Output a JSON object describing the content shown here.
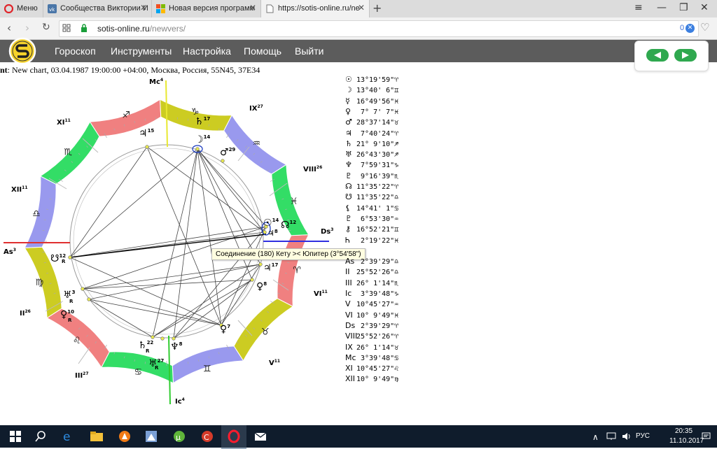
{
  "browser": {
    "tabs": [
      {
        "label": "Меню",
        "active": false
      },
      {
        "label": "Сообщества Виктории И",
        "active": false
      },
      {
        "label": "Новая версия программ",
        "active": false
      },
      {
        "label": "https://sotis-online.ru/ne",
        "active": true
      }
    ],
    "new_tab": "+",
    "url_host": "sotis-online.ru",
    "url_path": "/newvers/",
    "adblock_count": "0"
  },
  "site": {
    "menu": [
      "Гороскоп",
      "Инструменты",
      "Настройка",
      "Помощь",
      "Выйти"
    ],
    "chart_info_prefix": "nt",
    "chart_info": ": New chart, 03.04.1987 19:00:00 +04:00, Москва, Россия, 55N45, 37E34"
  },
  "wheel": {
    "zodiac_colors": {
      "fire": "#f08080",
      "earth": "#cccc22",
      "air": "#9999ee",
      "water": "#33dd66"
    },
    "house_labels": [
      {
        "label": "Mc",
        "sup": "4"
      },
      {
        "label": "IX",
        "sup": "27"
      },
      {
        "label": "VIII",
        "sup": "26"
      },
      {
        "label": "Ds",
        "sup": "3"
      },
      {
        "label": "VI",
        "sup": "11"
      },
      {
        "label": "V",
        "sup": "11"
      },
      {
        "label": "Ic",
        "sup": "4"
      },
      {
        "label": "III",
        "sup": "27"
      },
      {
        "label": "II",
        "sup": "26"
      },
      {
        "label": "As",
        "sup": "3"
      },
      {
        "label": "XII",
        "sup": "11"
      },
      {
        "label": "XI",
        "sup": "11"
      }
    ],
    "planet_labels": [
      {
        "glyph": "♄",
        "deg": "17"
      },
      {
        "glyph": "♃",
        "deg": "15"
      },
      {
        "glyph": "☽",
        "deg": "14"
      },
      {
        "glyph": "♂",
        "deg": "29"
      },
      {
        "glyph": "☉",
        "deg": "14"
      },
      {
        "glyph": "☊",
        "deg": "12"
      },
      {
        "glyph": "♃",
        "deg": "8"
      },
      {
        "glyph": "☋",
        "deg": "12",
        "retro": "R"
      },
      {
        "glyph": "♃",
        "deg": "17"
      },
      {
        "glyph": "♀",
        "deg": "8"
      },
      {
        "glyph": "♅",
        "deg": "3",
        "retro": "R"
      },
      {
        "glyph": "♀",
        "deg": "10",
        "retro": "R"
      },
      {
        "glyph": "♀",
        "deg": "7"
      },
      {
        "glyph": "♄",
        "deg": "22",
        "retro": "R"
      },
      {
        "glyph": "♆",
        "deg": "8"
      },
      {
        "glyph": "♅",
        "deg": "27",
        "retro": "R"
      }
    ]
  },
  "tooltip": "Соединение (180) Кету >< Юпитер (3°54'58\")",
  "planet_table": [
    {
      "glyph": "☉",
      "value": "13°19'59\"♈"
    },
    {
      "glyph": "☽",
      "value": "13°40' 6\"♊"
    },
    {
      "glyph": "☿",
      "value": "16°49'56\"♓"
    },
    {
      "glyph": "♀",
      "value": " 7° 7' 7\"♓"
    },
    {
      "glyph": "♂",
      "value": "28°37'14\"♉"
    },
    {
      "glyph": "♃",
      "value": " 7°40'24\"♈"
    },
    {
      "glyph": "♄",
      "value": "21° 9'10\"♐"
    },
    {
      "glyph": "♅",
      "value": "26°43'30\"♐"
    },
    {
      "glyph": "♆",
      "value": " 7°59'31\"♑"
    },
    {
      "glyph": "♇",
      "value": " 9°16'39\"♏"
    },
    {
      "glyph": "☊",
      "value": "11°35'22\"♈"
    },
    {
      "glyph": "☋",
      "value": "11°35'22\"♎"
    },
    {
      "glyph": "⚸",
      "value": "14°41' 1\"♋"
    },
    {
      "glyph": "♇",
      "value": " 6°53'30\"♒"
    },
    {
      "glyph": "⚷",
      "value": "16°52'21\"♊"
    },
    {
      "glyph": "Ꮒ",
      "value": " 2°19'22\"♓"
    },
    {
      "glyph": "",
      "value": ""
    },
    {
      "glyph": "As",
      "value": " 2°39'29\"♎"
    },
    {
      "glyph": "II",
      "value": "25°52'26\"♎"
    },
    {
      "glyph": "III",
      "value": "26° 1'14\"♏"
    },
    {
      "glyph": "Ic",
      "value": " 3°39'48\"♑"
    },
    {
      "glyph": "V",
      "value": "10°45'27\"♒"
    },
    {
      "glyph": "VI",
      "value": "10° 9'49\"♓"
    },
    {
      "glyph": "Ds",
      "value": " 2°39'29\"♈"
    },
    {
      "glyph": "VIII",
      "value": "25°52'26\"♈"
    },
    {
      "glyph": "IX",
      "value": "26° 1'14\"♉"
    },
    {
      "glyph": "Mc",
      "value": " 3°39'48\"♋"
    },
    {
      "glyph": "XI",
      "value": "10°45'27\"♌"
    },
    {
      "glyph": "XII",
      "value": "10° 9'49\"♍"
    }
  ],
  "taskbar": {
    "lang": "РУС",
    "time": "20:35",
    "date": "11.10.2017",
    "icons": [
      "windows-start-icon",
      "search-icon",
      "edge-icon",
      "file-explorer-icon",
      "avast-icon",
      "app-icon",
      "utorrent-icon",
      "ccleaner-icon",
      "opera-icon",
      "mail-icon"
    ]
  }
}
